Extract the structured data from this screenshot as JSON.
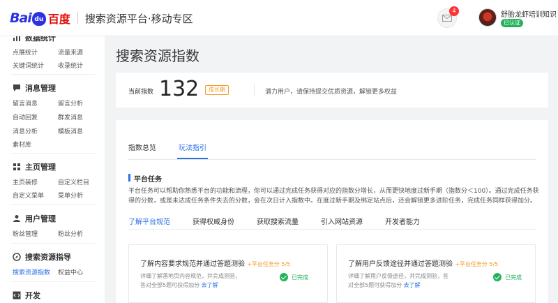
{
  "header": {
    "logo_bai": "Bai",
    "logo_du": "du",
    "logo_cn": "百度",
    "title": "搜索资源平台·移动专区",
    "message_count": "4",
    "user_name": "舒胎龙虾培训知识",
    "verified": "已认证"
  },
  "sidebar": {
    "sections": [
      {
        "title": "数据统计",
        "icon": "chart-icon",
        "items": [
          [
            "点展统计",
            "流量来源"
          ],
          [
            "关键词统计",
            "收录统计"
          ]
        ]
      },
      {
        "title": "消息管理",
        "icon": "message-icon",
        "items": [
          [
            "留言消息",
            "留言分析"
          ],
          [
            "自动回复",
            "群发消息"
          ],
          [
            "消息分析",
            "模板消息"
          ],
          [
            "素材库",
            ""
          ]
        ]
      },
      {
        "title": "主页管理",
        "icon": "grid-icon",
        "items": [
          [
            "主页装修",
            "自定义栏目"
          ],
          [
            "自定义菜单",
            "菜单分析"
          ]
        ]
      },
      {
        "title": "用户管理",
        "icon": "user-icon",
        "items": [
          [
            "粉丝管理",
            "粉丝分析"
          ]
        ]
      },
      {
        "title": "搜索资源指导",
        "icon": "compass-icon",
        "items": [
          [
            "搜索资源指数",
            "权益中心"
          ]
        ]
      },
      {
        "title": "开发",
        "icon": "code-icon",
        "items": []
      }
    ],
    "active_item": "搜索资源指数"
  },
  "main": {
    "page_title": "搜索资源指数",
    "index": {
      "label": "当前指数",
      "value": "132",
      "badge": "成长期",
      "tip": "潜力用户，请保持提交优质资源，解锁更多权益"
    },
    "tabs": [
      {
        "label": "指数总览",
        "active": false
      },
      {
        "label": "玩法指引",
        "active": true
      }
    ],
    "section_title": "平台任务",
    "description": "平台任务可以帮助你熟悉平台的功能和流程，你可以通过完成任务获得对应的指数分增长，从而更快地度过新手期（指数分＜100）。通过完成任务获得的分数，或是未达成任务条件失去的分数，会在次日计入指数中。在度过新手期及绑定站点后，还会解锁更多进阶任务，完成任务同样获得加分。",
    "subtabs": [
      "了解平台规范",
      "获得权威身份",
      "获取搜索流量",
      "引入网站资源",
      "开发者能力"
    ],
    "tasks": [
      {
        "title": "了解内容要求规范并通过答题测验",
        "reward": "+平台任务分 5/5",
        "desc_line1": "详细了解落地页内容规范，并完成测验，",
        "desc_line2": "答对全部5题可获得加分",
        "link": "去了解",
        "status": "已完成"
      },
      {
        "title": "了解用户反馈途径并通过答题测验",
        "reward": "+平台任务分 5/5",
        "desc_line1": "详细了解用户反馈途径，并完成测验，答",
        "desc_line2": "对全部5题可获得加分",
        "link": "去了解",
        "status": "已完成"
      }
    ]
  },
  "colors": {
    "accent": "#2b6fe6",
    "orange": "#f59b22",
    "green": "#24b35c",
    "badge_red": "#ff3333"
  }
}
